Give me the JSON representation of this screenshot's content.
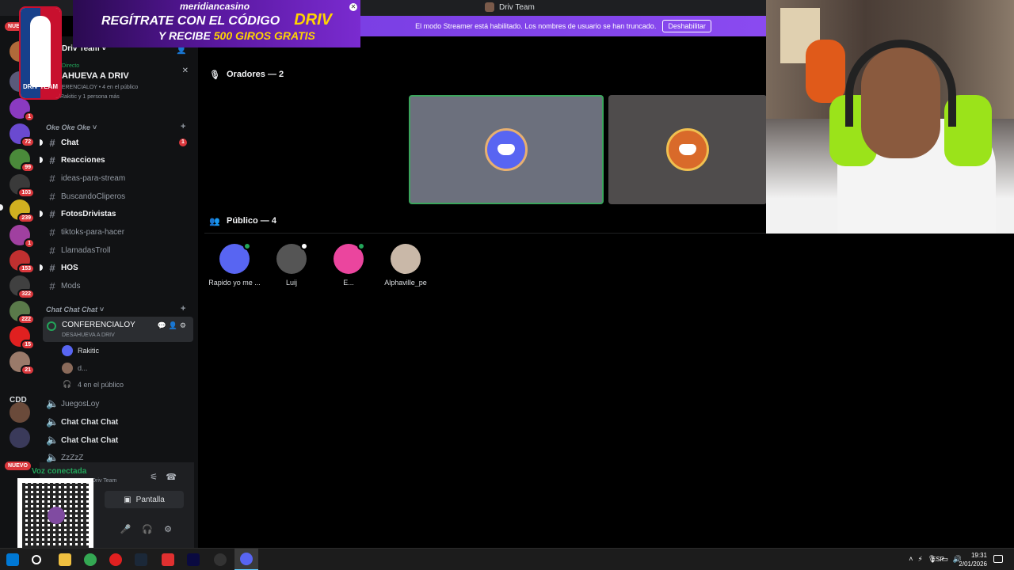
{
  "window": {
    "title": "Driv Team"
  },
  "streamer_banner": {
    "text": "El modo Streamer está habilitado. Los nombres de usuario se han truncado.",
    "button": "Deshabilitar"
  },
  "ad": {
    "brand": "meridiancasino",
    "line1": "REGÍTRATE CON EL CÓDIGO",
    "code": "DRIV",
    "line2a": "Y RECIBE",
    "line2b": "500 GIROS GRATIS"
  },
  "logo": {
    "text": "DRIV TEAM"
  },
  "rail": {
    "badge_nuevo_top": "NUE",
    "badges": [
      "1",
      "72",
      "99",
      "103",
      "239",
      "1",
      "153",
      "322",
      "222",
      "15",
      "21"
    ],
    "cdd": "CDD",
    "nuevo": "NUEVO"
  },
  "sidebar": {
    "server_name": "Driv Team",
    "stage": {
      "live": "Directo",
      "name": "AHUEVA A DRIV",
      "meta": "CONFERENCIALOY • 4 en el público",
      "meta2": "Rakitic y 1 persona más"
    },
    "cat1": "Oke Oke Oke",
    "channels": [
      {
        "name": "Chat",
        "bold": true,
        "badge": "1"
      },
      {
        "name": "Reacciones",
        "bold": true
      },
      {
        "name": "ideas-para-stream",
        "bold": false
      },
      {
        "name": "BuscandoCliperos",
        "bold": false
      },
      {
        "name": "FotosDrivistas",
        "bold": true
      },
      {
        "name": "tiktoks-para-hacer",
        "bold": false
      },
      {
        "name": "LlamadasTroll",
        "bold": false
      },
      {
        "name": "HOS",
        "bold": true
      },
      {
        "name": "Mods",
        "bold": false
      }
    ],
    "cat2": "Chat Chat Chat",
    "voice_active": {
      "name": "CONFERENCIALOY",
      "sub": "DESAHUEVA A DRIV"
    },
    "users": [
      "Rakitic",
      "d...",
      "4 en el público"
    ],
    "voice_channels": [
      "JuegosLoy",
      "Chat Chat Chat",
      "Chat Chat Chat",
      "ZzZzZ"
    ]
  },
  "voice_panel": {
    "status": "Voz conectada",
    "sub": "Driv Team",
    "screen": "Pantalla"
  },
  "stage_main": {
    "speakers_title": "Oradores — 2",
    "audience_title": "Público — 4",
    "audience": [
      {
        "name": "Rapido yo me ...",
        "color": "#5865f2",
        "status": true
      },
      {
        "name": "Luij",
        "color": "#555555",
        "status": false
      },
      {
        "name": "E...",
        "color": "#eb459e",
        "status": true
      },
      {
        "name": "Alphaville_pe",
        "color": "#c9b8a8",
        "status": false
      }
    ]
  },
  "taskbar": {
    "lang": "ESP",
    "time": "19:31",
    "date": "2/01/2026"
  }
}
